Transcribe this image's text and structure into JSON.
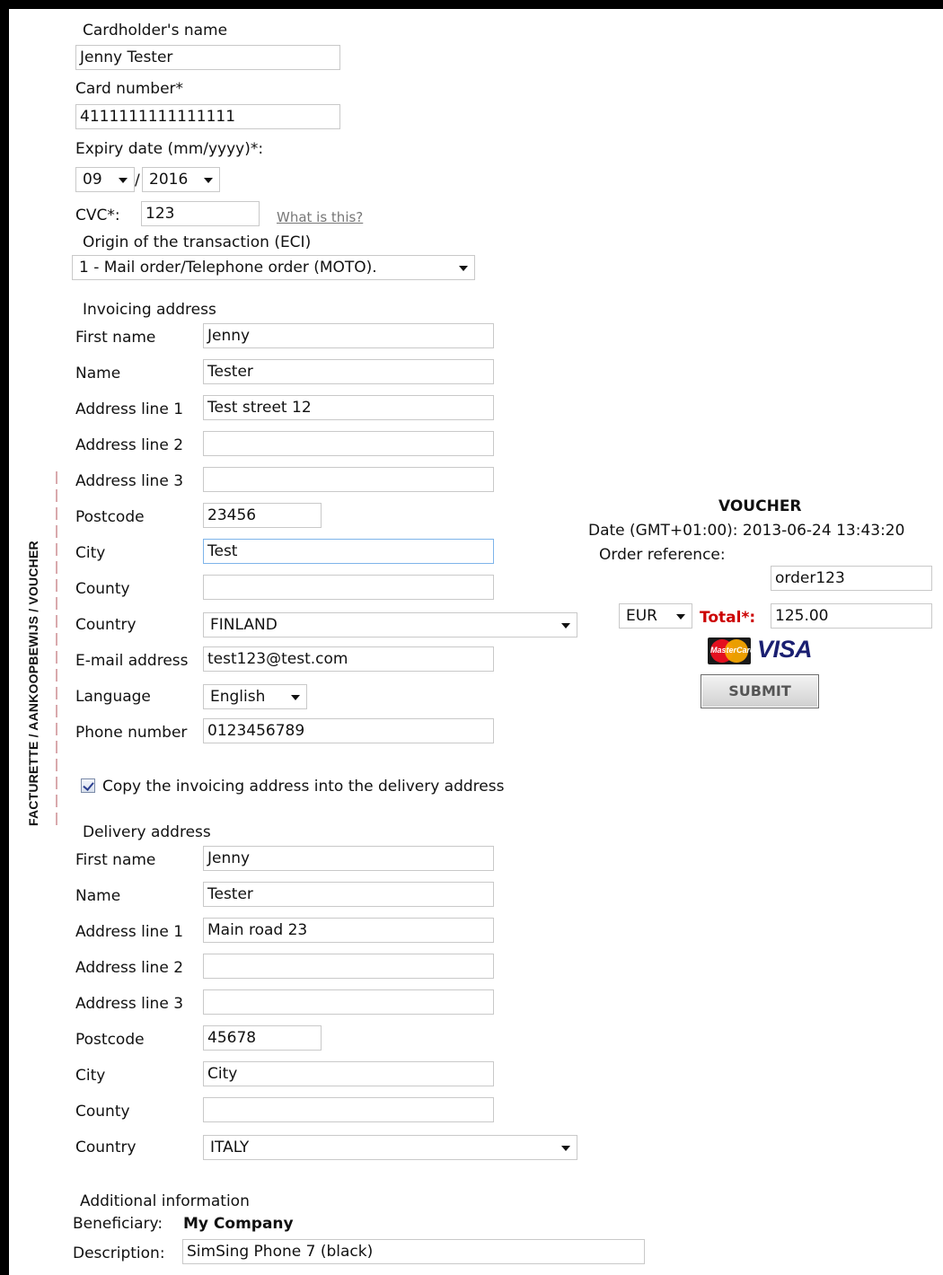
{
  "side_label": "FACTURETTE / AANKOOPBEWIJS / VOUCHER",
  "card": {
    "cardholder_label": "Cardholder's name",
    "cardholder_value": "Jenny Tester",
    "number_label": "Card number*",
    "number_value": "4111111111111111",
    "expiry_label": "Expiry date (mm/yyyy)*:",
    "expiry_month": "09",
    "expiry_sep": "/",
    "expiry_year": "2016",
    "cvc_label": "CVC*:",
    "cvc_value": "123",
    "cvc_help": "What is this?",
    "eci_label": "Origin of the transaction (ECI)",
    "eci_value": "1 - Mail order/Telephone order (MOTO)."
  },
  "invoicing": {
    "heading": "Invoicing address",
    "first_name_label": "First name",
    "first_name": "Jenny",
    "name_label": "Name",
    "name": "Tester",
    "addr1_label": "Address line 1",
    "addr1": "Test street 12",
    "addr2_label": "Address line 2",
    "addr2": "",
    "addr3_label": "Address line 3",
    "addr3": "",
    "postcode_label": "Postcode",
    "postcode": "23456",
    "city_label": "City",
    "city": "Test",
    "county_label": "County",
    "county": "",
    "country_label": "Country",
    "country": "FINLAND",
    "email_label": "E-mail address",
    "email": "test123@test.com",
    "language_label": "Language",
    "language": "English",
    "phone_label": "Phone number",
    "phone": "0123456789"
  },
  "copy_address": {
    "label": "Copy the invoicing address into the delivery address",
    "checked": true
  },
  "delivery": {
    "heading": "Delivery address",
    "first_name_label": "First name",
    "first_name": "Jenny",
    "name_label": "Name",
    "name": "Tester",
    "addr1_label": "Address line 1",
    "addr1": "Main road 23",
    "addr2_label": "Address line 2",
    "addr2": "",
    "addr3_label": "Address line 3",
    "addr3": "",
    "postcode_label": "Postcode",
    "postcode": "45678",
    "city_label": "City",
    "city": "City",
    "county_label": "County",
    "county": "",
    "country_label": "Country",
    "country": "ITALY"
  },
  "additional": {
    "heading": "Additional information",
    "beneficiary_label": "Beneficiary:",
    "beneficiary_value": "My Company",
    "description_label": "Description:",
    "description_value": "SimSing Phone 7 (black)"
  },
  "voucher": {
    "title": "VOUCHER",
    "date_text": "Date (GMT+01:00): 2013-06-24 13:43:20",
    "order_ref_label": "Order reference:",
    "order_ref_value": "order123",
    "currency": "EUR",
    "total_label": "Total*:",
    "total_value": "125.00",
    "mastercard_text": "MasterCard",
    "visa_text": "VISA",
    "submit_label": "SUBMIT"
  },
  "colors": {
    "total_label": "#cc0000",
    "visa": "#1a1f71",
    "dash": "#d9a9ad"
  }
}
